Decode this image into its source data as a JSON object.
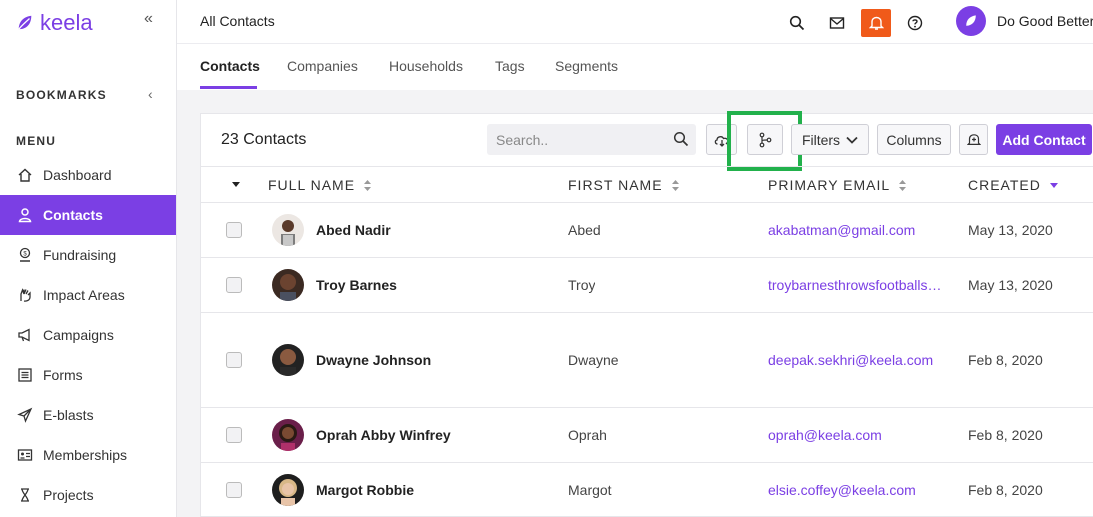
{
  "brand": {
    "name": "keela",
    "accent": "#7b3fe4"
  },
  "sidebar": {
    "bookmarks_label": "BOOKMARKS",
    "menu_label": "MENU",
    "items": [
      {
        "label": "Dashboard",
        "icon": "home-icon",
        "active": false
      },
      {
        "label": "Contacts",
        "icon": "person-icon",
        "active": true
      },
      {
        "label": "Fundraising",
        "icon": "donation-icon",
        "active": false
      },
      {
        "label": "Impact Areas",
        "icon": "hand-icon",
        "active": false
      },
      {
        "label": "Campaigns",
        "icon": "megaphone-icon",
        "active": false
      },
      {
        "label": "Forms",
        "icon": "form-icon",
        "active": false
      },
      {
        "label": "E-blasts",
        "icon": "send-icon",
        "active": false
      },
      {
        "label": "Memberships",
        "icon": "id-card-icon",
        "active": false
      },
      {
        "label": "Projects",
        "icon": "hourglass-icon",
        "active": false
      }
    ]
  },
  "header": {
    "title": "All Contacts",
    "user_name": "Do Good Better",
    "notification_color": "#f05a1a"
  },
  "tabs": [
    {
      "label": "Contacts",
      "active": true
    },
    {
      "label": "Companies",
      "active": false
    },
    {
      "label": "Households",
      "active": false
    },
    {
      "label": "Tags",
      "active": false
    },
    {
      "label": "Segments",
      "active": false
    }
  ],
  "toolbar": {
    "count_label": "23 Contacts",
    "search_placeholder": "Search..",
    "filters_label": "Filters",
    "columns_label": "Columns",
    "add_label": "Add Contact"
  },
  "table": {
    "columns": [
      "FULL NAME",
      "FIRST NAME",
      "PRIMARY EMAIL",
      "CREATED"
    ],
    "rows": [
      {
        "full_name": "Abed Nadir",
        "first_name": "Abed",
        "email": "akabatman@gmail.com",
        "created": "May 13, 2020"
      },
      {
        "full_name": "Troy Barnes",
        "first_name": "Troy",
        "email": "troybarnesthrowsfootballs…",
        "created": "May 13, 2020"
      },
      {
        "full_name": "Dwayne Johnson",
        "first_name": "Dwayne",
        "email": "deepak.sekhri@keela.com",
        "created": "Feb 8, 2020"
      },
      {
        "full_name": "Oprah Abby Winfrey",
        "first_name": "Oprah",
        "email": "oprah@keela.com",
        "created": "Feb 8, 2020"
      },
      {
        "full_name": "Margot Robbie",
        "first_name": "Margot",
        "email": "elsie.coffey@keela.com",
        "created": "Feb 8, 2020"
      }
    ]
  }
}
